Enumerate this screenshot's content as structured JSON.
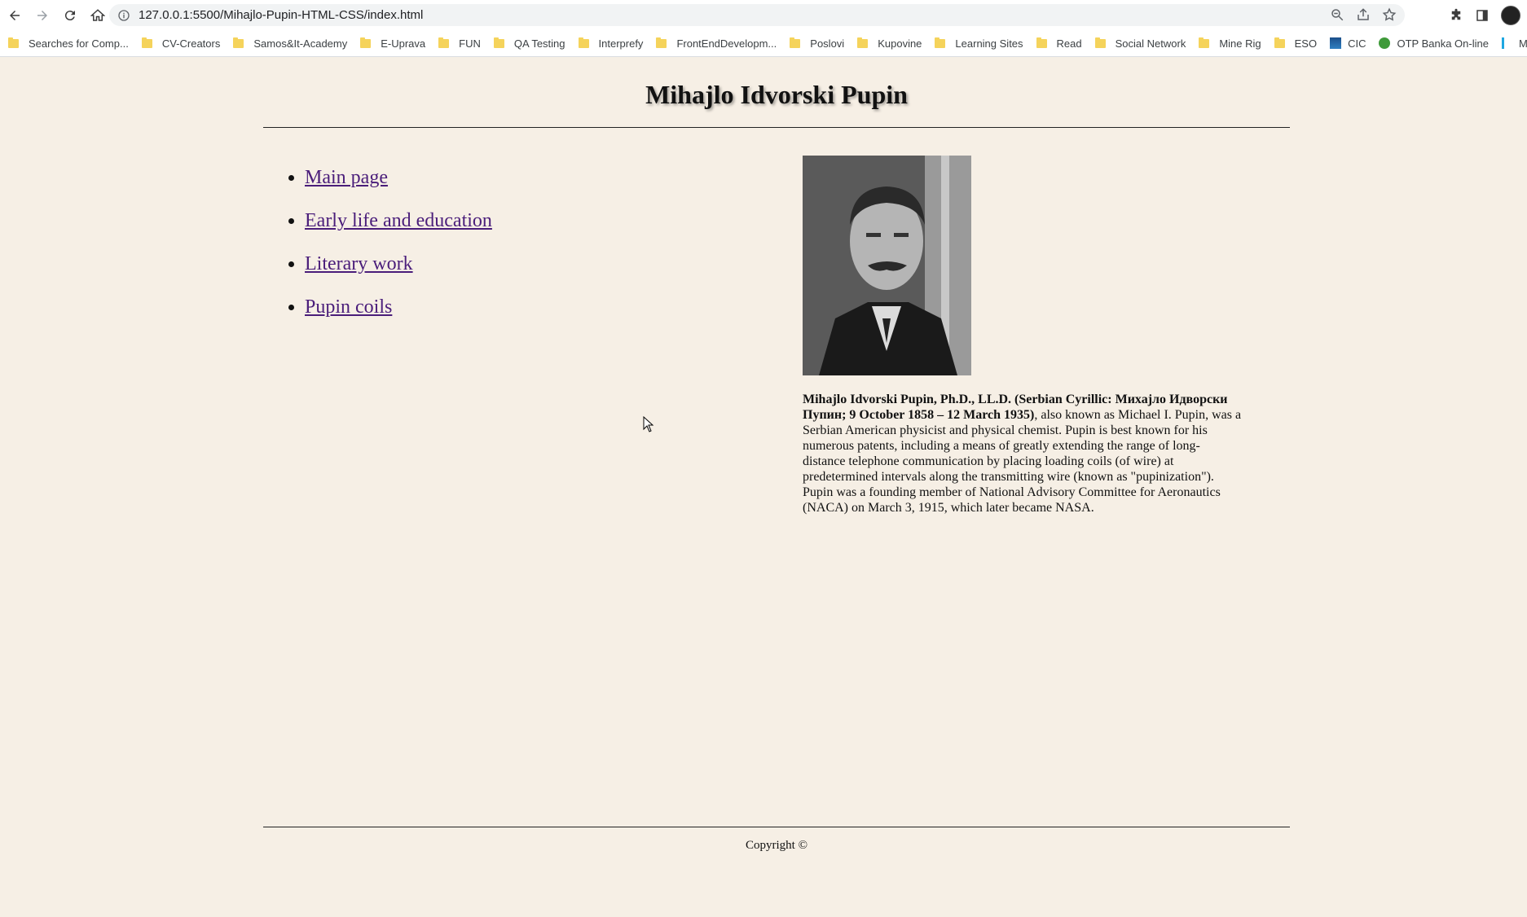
{
  "browser": {
    "url": "127.0.0.1:5500/Mihajlo-Pupin-HTML-CSS/index.html",
    "bookmarks": [
      {
        "label": "Searches for Comp...",
        "icon": "folder-icon"
      },
      {
        "label": "CV-Creators",
        "icon": "folder-icon"
      },
      {
        "label": "Samos&It-Academy",
        "icon": "folder-icon"
      },
      {
        "label": "E-Uprava",
        "icon": "folder-icon"
      },
      {
        "label": "FUN",
        "icon": "folder-icon"
      },
      {
        "label": "QA Testing",
        "icon": "folder-icon"
      },
      {
        "label": "Interprefy",
        "icon": "folder-icon"
      },
      {
        "label": "FrontEndDevelopm...",
        "icon": "folder-icon"
      },
      {
        "label": "Poslovi",
        "icon": "folder-icon"
      },
      {
        "label": "Kupovine",
        "icon": "folder-icon"
      },
      {
        "label": "Learning Sites",
        "icon": "folder-icon"
      },
      {
        "label": "Read",
        "icon": "folder-icon"
      },
      {
        "label": "Social Network",
        "icon": "folder-icon"
      },
      {
        "label": "Mine Rig",
        "icon": "folder-icon"
      },
      {
        "label": "ESO",
        "icon": "folder-icon"
      },
      {
        "label": "CIC",
        "icon": "cic-favicon"
      },
      {
        "label": "OTP Banka On-line",
        "icon": "otp-favicon"
      },
      {
        "label": "Moj Telenor",
        "icon": "telenor-favicon"
      }
    ]
  },
  "page": {
    "title": "Mihajlo Idvorski Pupin",
    "nav": [
      {
        "label": "Main page"
      },
      {
        "label": "Early life and education"
      },
      {
        "label": "Literary work"
      },
      {
        "label": "Pupin coils"
      }
    ],
    "bio": {
      "bold": "Mihajlo Idvorski Pupin, Ph.D., LL.D. (Serbian Cyrillic: Михајло Идворски Пупин; 9 October 1858 – 12 March 1935)",
      "rest": ", also known as Michael I. Pupin, was a Serbian American physicist and physical chemist. Pupin is best known for his numerous patents, including a means of greatly extending the range of long-distance telephone communication by placing loading coils (of wire) at predetermined intervals along the transmitting wire (known as \"pupinization\"). Pupin was a founding member of National Advisory Committee for Aeronautics (NACA) on March 3, 1915, which later became NASA."
    },
    "footer": "Copyright ©"
  },
  "colors": {
    "background": "#f6efe5",
    "link": "#4a1d7a",
    "folder": "#f5d35b"
  }
}
